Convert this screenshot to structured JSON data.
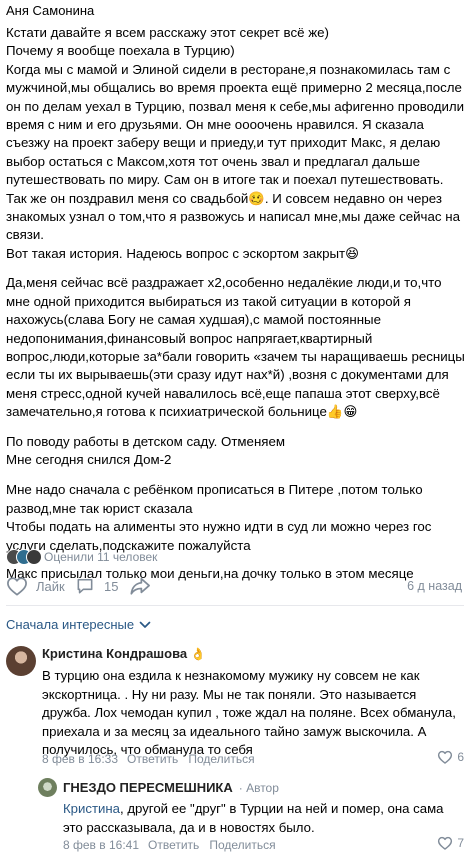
{
  "post": {
    "author": "Аня Самонина",
    "paragraphs": [
      "Кстати давайте я всем расскажу этот секрет всё же)\nПочему я вообще поехала в Турцию)\nКогда мы с мамой и Элиной сидели в ресторане,я познакомилась там с мужчиной,мы общались во время проекта ещё примерно 2 месяца,после он по делам уехал в Турцию, позвал меня к себе,мы афигенно проводили время с ним и его друзьями. Он мне оооочень нравился. Я сказала съезжу на проект заберу вещи и приеду,и тут приходит Макс, я делаю выбор остаться с Максом,хотя тот очень звал и предлагал дальше путешествовать по миру. Сам он в итоге так и поехал путешествовать. Так же он поздравил меня со свадьбой🥴. И совсем недавно он через знакомых узнал о том,что я развожусь и написал мне,мы даже сейчас на связи.\nВот такая история. Надеюсь вопрос с эскортом закрыт😆",
      "Да,меня сейчас всё раздражает х2,особенно недалёкие люди,и то,что мне одной приходится выбираться из такой ситуации в которой я нахожусь(слава Богу не самая худшая),с мамой постоянные недопонимания,финансовый вопрос напрягает,квартирный вопрос,люди,которые за*бали говорить «зачем ты наращиваешь ресницы если ты их вырываешь(эти сразу идут нах*й) ,возня с документами для меня стресс,одной кучей навалилось всё,еще папаша этот сверху,всё замечательно,я готова к психиатрической больнице👍😁",
      "По поводу работы в детском саду. Отменяем\nМне сегодня снился Дом-2",
      "Мне надо сначала с ребёнком прописаться в Питере ,потом только развод,мне так юрист сказала\nЧтобы подать на алименты это нужно идти в суд ли можно через гос услуги сделать,подскажите пожалуйста",
      "Макс присылал только мои деньги,на дочку только в этом месяце"
    ],
    "viewers_text": "Оценили 11 человек",
    "like_label": "Лайк",
    "comments_count": "15",
    "time": "6 д назад"
  },
  "sort_label": "Сначала интересные",
  "comments": [
    {
      "author": "Кристина Кондрашова",
      "author_emoji": "👌",
      "text": "В турцию она ездила к незнакомому мужику ну совсем не как экскортница. . Ну ни разу. Мы не так поняли. Это называется дружба. Лох чемодан купил , тоже ждал на поляне. Всех обманула, приехала и за месяц за идеального тайно замуж выскочила. А получилось, что обманула то себя",
      "time": "8 фев в 16:33",
      "reply_label": "Ответить",
      "share_label": "Поделиться",
      "likes": "6"
    },
    {
      "author": "ГНЕЗДО ПЕРЕСМЕШНИКА",
      "badge": "· Автор",
      "mention": "Кристина",
      "text": ", другой ее \"друг\" в Турции на ней и помер, она сама это рассказывала, да и в новостях было.",
      "time": "8 фев в 16:41",
      "reply_label": "Ответить",
      "share_label": "Поделиться",
      "likes": "7"
    }
  ],
  "colors": {
    "link": "#2a5885",
    "muted": "#818c99",
    "divider": "#e7e8ec"
  },
  "icons": [
    "heart-icon",
    "comment-icon",
    "share-icon",
    "chevron-down-icon"
  ]
}
